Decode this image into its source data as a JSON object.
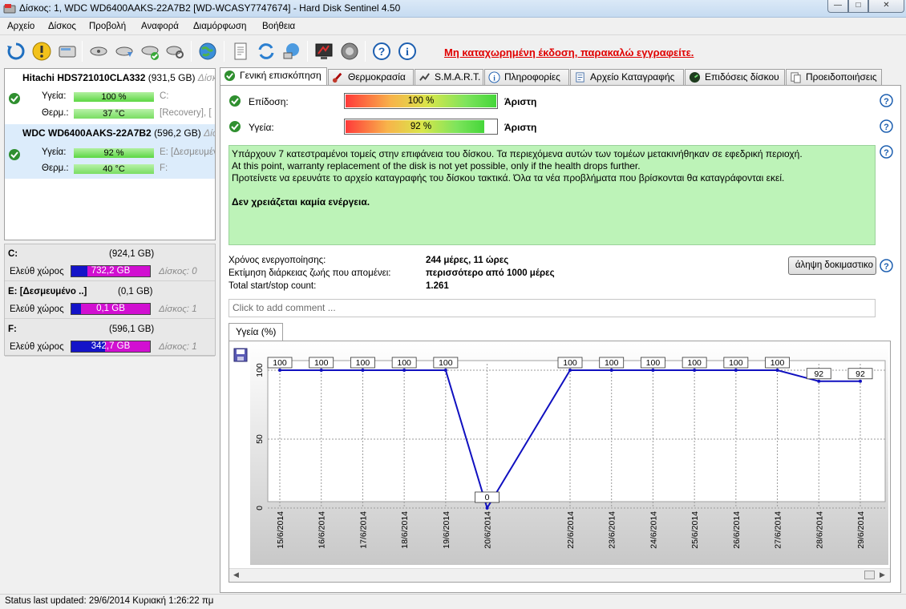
{
  "window": {
    "title": "Δίσκος: 1, WDC WD6400AAKS-22A7B2 [WD-WCASY7747674]  -  Hard Disk Sentinel 4.50",
    "minimize": "—",
    "maximize": "□",
    "close": "✕"
  },
  "menu": [
    "Αρχείο",
    "Δίσκος",
    "Προβολή",
    "Αναφορά",
    "Διαμόρφωση",
    "Βοήθεια"
  ],
  "toolbar": {
    "icons": [
      "refresh-icon",
      "warning-icon",
      "disk-icon",
      "disk-test-icon",
      "disk-test-2-icon",
      "disk-check-icon",
      "disk-search-icon",
      "globe-icon",
      "report-icon",
      "sync-icon",
      "network-icon",
      "monitor-icon",
      "speaker-icon",
      "help-icon",
      "info-icon"
    ],
    "registration_note": "Μη καταχωρημένη έκδοση, παρακαλώ εγγραφείτε."
  },
  "disks": [
    {
      "name": "Hitachi HDS721010CLA332",
      "capacity": "(931,5 GB)",
      "tag": "Δίσκ",
      "health_label": "Υγεία:",
      "health": "100 %",
      "health_value": 100,
      "temp_label": "Θερμ.:",
      "temp": "37 °C",
      "side1": "C:",
      "side2": "[Recovery], [",
      "selected": false
    },
    {
      "name": "WDC WD6400AAKS-22A7B2",
      "capacity": "(596,2 GB)",
      "tag": "Δίσ",
      "health_label": "Υγεία:",
      "health": "92 %",
      "health_value": 92,
      "temp_label": "Θερμ.:",
      "temp": "40 °C",
      "side1": "E: [Δεσμευμέν",
      "side2": "F:",
      "selected": true
    }
  ],
  "partitions": [
    {
      "name": "C:",
      "size": "(924,1 GB)",
      "free_label": "Ελεύθ χώρος",
      "free": "732,2 GB",
      "used_fraction": 0.2,
      "disk": "Δίσκος: 0"
    },
    {
      "name": "E: [Δεσμευμένο ..]",
      "size": "(0,1 GB)",
      "free_label": "Ελεύθ χώρος",
      "free": "0,1 GB",
      "used_fraction": 0.12,
      "disk": "Δίσκος: 1"
    },
    {
      "name": "F:",
      "size": "(596,1 GB)",
      "free_label": "Ελεύθ χώρος",
      "free": "342,7 GB",
      "used_fraction": 0.43,
      "disk": "Δίσκος: 1"
    }
  ],
  "tabs": [
    "Γενική επισκόπηση",
    "Θερμοκρασία",
    "S.M.A.R.T.",
    "Πληροφορίες",
    "Αρχείο Καταγραφής",
    "Επιδόσεις δίσκου",
    "Προειδοποιήσεις"
  ],
  "overview": {
    "performance_label": "Επίδοση:",
    "performance": "100 %",
    "performance_value": 100,
    "performance_rating": "Άριστη",
    "health_label": "Υγεία:",
    "health": "92 %",
    "health_value": 92,
    "health_rating": "Άριστη",
    "info_lines": [
      "Υπάρχουν 7 κατεστραμένοι τομείς στην επιφάνεια του δίσκου. Τα περιεχόμενα αυτών των τομέων μετακινήθηκαν σε εφεδρική περιοχή.",
      "At this point, warranty replacement of the disk is not yet possible, only if the health drops further.",
      "Προτείνετε να ερευνάτε το αρχείο καταγραφής του δίσκου τακτικά. Όλα τα νέα προβλήματα που βρίσκονται θα καταγράφονται εκεί."
    ],
    "action": "Δεν χρειάζεται καμία ενέργεια.",
    "power_on_label": "Χρόνος ενεργοποίησης:",
    "power_on": "244 μέρες, 11 ώρες",
    "lifetime_label": "Εκτίμηση διάρκειας ζωής που απομένει:",
    "lifetime": "περισσότερο από 1000 μέρες",
    "startstop_label": "Total start/stop count:",
    "startstop": "1.261",
    "test_button": "άληψη δοκιμαστικο",
    "comment_placeholder": "Click to add comment ..."
  },
  "chart_tab": "Υγεία (%)",
  "chart_data": {
    "type": "line",
    "title": "",
    "xlabel": "",
    "ylabel": "",
    "ylim": [
      0,
      100
    ],
    "yticks": [
      0,
      50,
      100
    ],
    "x": [
      "15/6/2014",
      "16/6/2014",
      "17/6/2014",
      "18/6/2014",
      "19/6/2014",
      "20/6/2014",
      "22/6/2014",
      "23/6/2014",
      "24/6/2014",
      "25/6/2014",
      "26/6/2014",
      "27/6/2014",
      "28/6/2014",
      "29/6/2014"
    ],
    "x_days": [
      15,
      16,
      17,
      18,
      19,
      20,
      22,
      23,
      24,
      25,
      26,
      27,
      28,
      29
    ],
    "series": [
      {
        "values": [
          100,
          100,
          100,
          100,
          100,
          0,
          100,
          100,
          100,
          100,
          100,
          100,
          92,
          92
        ],
        "color": "#1010c0"
      }
    ],
    "grid": true,
    "background": "gradient-gray"
  },
  "status": "Status last updated: 29/6/2014 Κυριακή 1:26:22 πμ"
}
